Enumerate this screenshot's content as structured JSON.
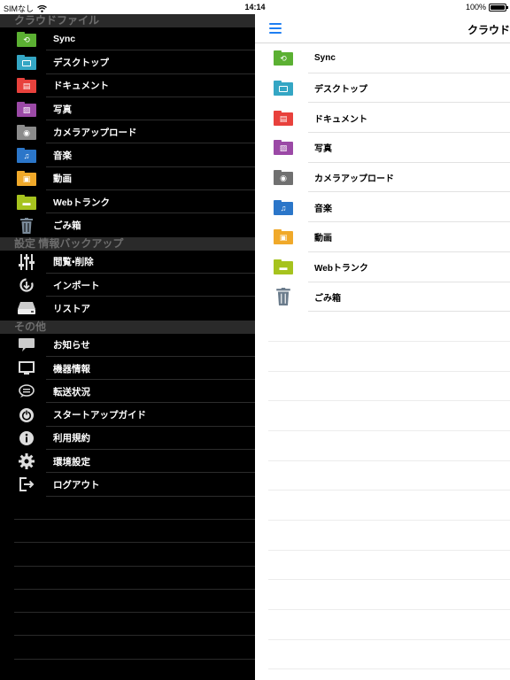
{
  "status": {
    "carrier": "SIMなし",
    "time": "14:14",
    "battery": "100%"
  },
  "colors": {
    "sync": "#5bb032",
    "desktop": "#34a6c4",
    "document": "#e8413c",
    "photo": "#9b49a6",
    "camera": "#8b8b8b",
    "music": "#2b76c9",
    "video": "#f0a92a",
    "web": "#a6c31e",
    "accent": "#1e7ef2"
  },
  "sidebar": {
    "cloud_header": "クラウドファイル",
    "cloud_items": [
      {
        "label": "Sync",
        "icon": "sync-folder-icon"
      },
      {
        "label": "デスクトップ",
        "icon": "desktop-folder-icon"
      },
      {
        "label": "ドキュメント",
        "icon": "document-folder-icon"
      },
      {
        "label": "写真",
        "icon": "photo-folder-icon"
      },
      {
        "label": "カメラアップロード",
        "icon": "camera-folder-icon"
      },
      {
        "label": "音楽",
        "icon": "music-folder-icon"
      },
      {
        "label": "動画",
        "icon": "video-folder-icon"
      },
      {
        "label": "Webトランク",
        "icon": "web-trunk-folder-icon"
      },
      {
        "label": "ごみ箱",
        "icon": "trash-icon"
      }
    ],
    "settings_header": "設定 情報バックアップ",
    "settings_items": [
      {
        "label": "閲覧•削除",
        "icon": "sliders-icon"
      },
      {
        "label": "インポート",
        "icon": "import-icon"
      },
      {
        "label": "リストア",
        "icon": "drive-icon"
      }
    ],
    "other_header": "その他",
    "other_items": [
      {
        "label": "お知らせ",
        "icon": "speech-bubble-icon"
      },
      {
        "label": "機器情報",
        "icon": "monitor-icon"
      },
      {
        "label": "転送状況",
        "icon": "chat-icon"
      },
      {
        "label": "スタートアップガイド",
        "icon": "power-icon"
      },
      {
        "label": "利用規約",
        "icon": "info-icon"
      },
      {
        "label": "環境設定",
        "icon": "gear-icon"
      },
      {
        "label": "ログアウト",
        "icon": "logout-icon"
      }
    ]
  },
  "main": {
    "title": "クラウド",
    "items": [
      {
        "label": "Sync"
      },
      {
        "label": "デスクトップ"
      },
      {
        "label": "ドキュメント"
      },
      {
        "label": "写真"
      },
      {
        "label": "カメラアップロード"
      },
      {
        "label": "音楽"
      },
      {
        "label": "動画"
      },
      {
        "label": "Webトランク"
      },
      {
        "label": "ごみ箱"
      }
    ]
  }
}
